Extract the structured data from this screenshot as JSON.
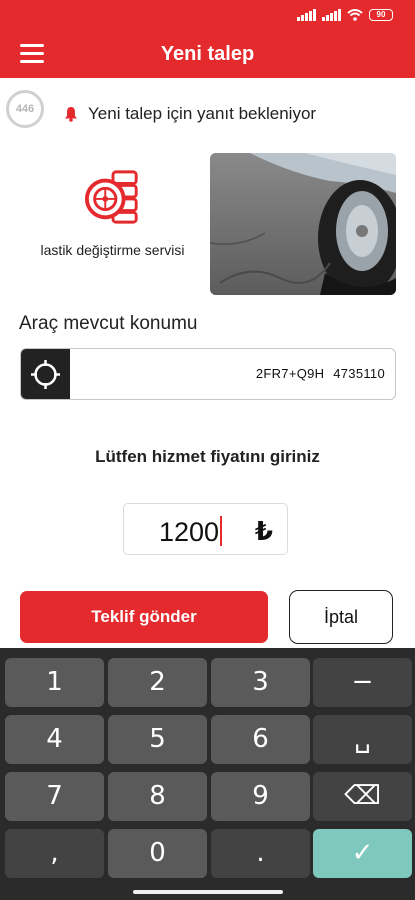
{
  "status_bar": {
    "battery": "90"
  },
  "app_bar": {
    "title": "Yeni talep"
  },
  "request": {
    "counter": "446",
    "waiting_text": "Yeni talep için yanıt bekleniyor"
  },
  "service": {
    "label": "lastik değiştirme servisi",
    "icon": "tire-service-icon"
  },
  "location": {
    "title": "Araç mevcut konumu",
    "value": "2FR7+Q9H 4735110"
  },
  "price": {
    "prompt": "Lütfen hizmet fiyatını giriniz",
    "value": "1200",
    "currency": "₺"
  },
  "actions": {
    "offer_label": "Teklif gönder",
    "cancel_label": "İptal"
  },
  "keyboard": {
    "keys": [
      "1",
      "2",
      "3",
      "−",
      "4",
      "5",
      "6",
      "␣",
      "7",
      "8",
      "9",
      "⌫",
      ",",
      "0",
      ".",
      "✓"
    ]
  },
  "colors": {
    "brand": "#e52a2e",
    "keyboard_bg": "#2b2b2b",
    "key_bg": "#5a5a5a",
    "key_ok": "#7fc8bd"
  }
}
